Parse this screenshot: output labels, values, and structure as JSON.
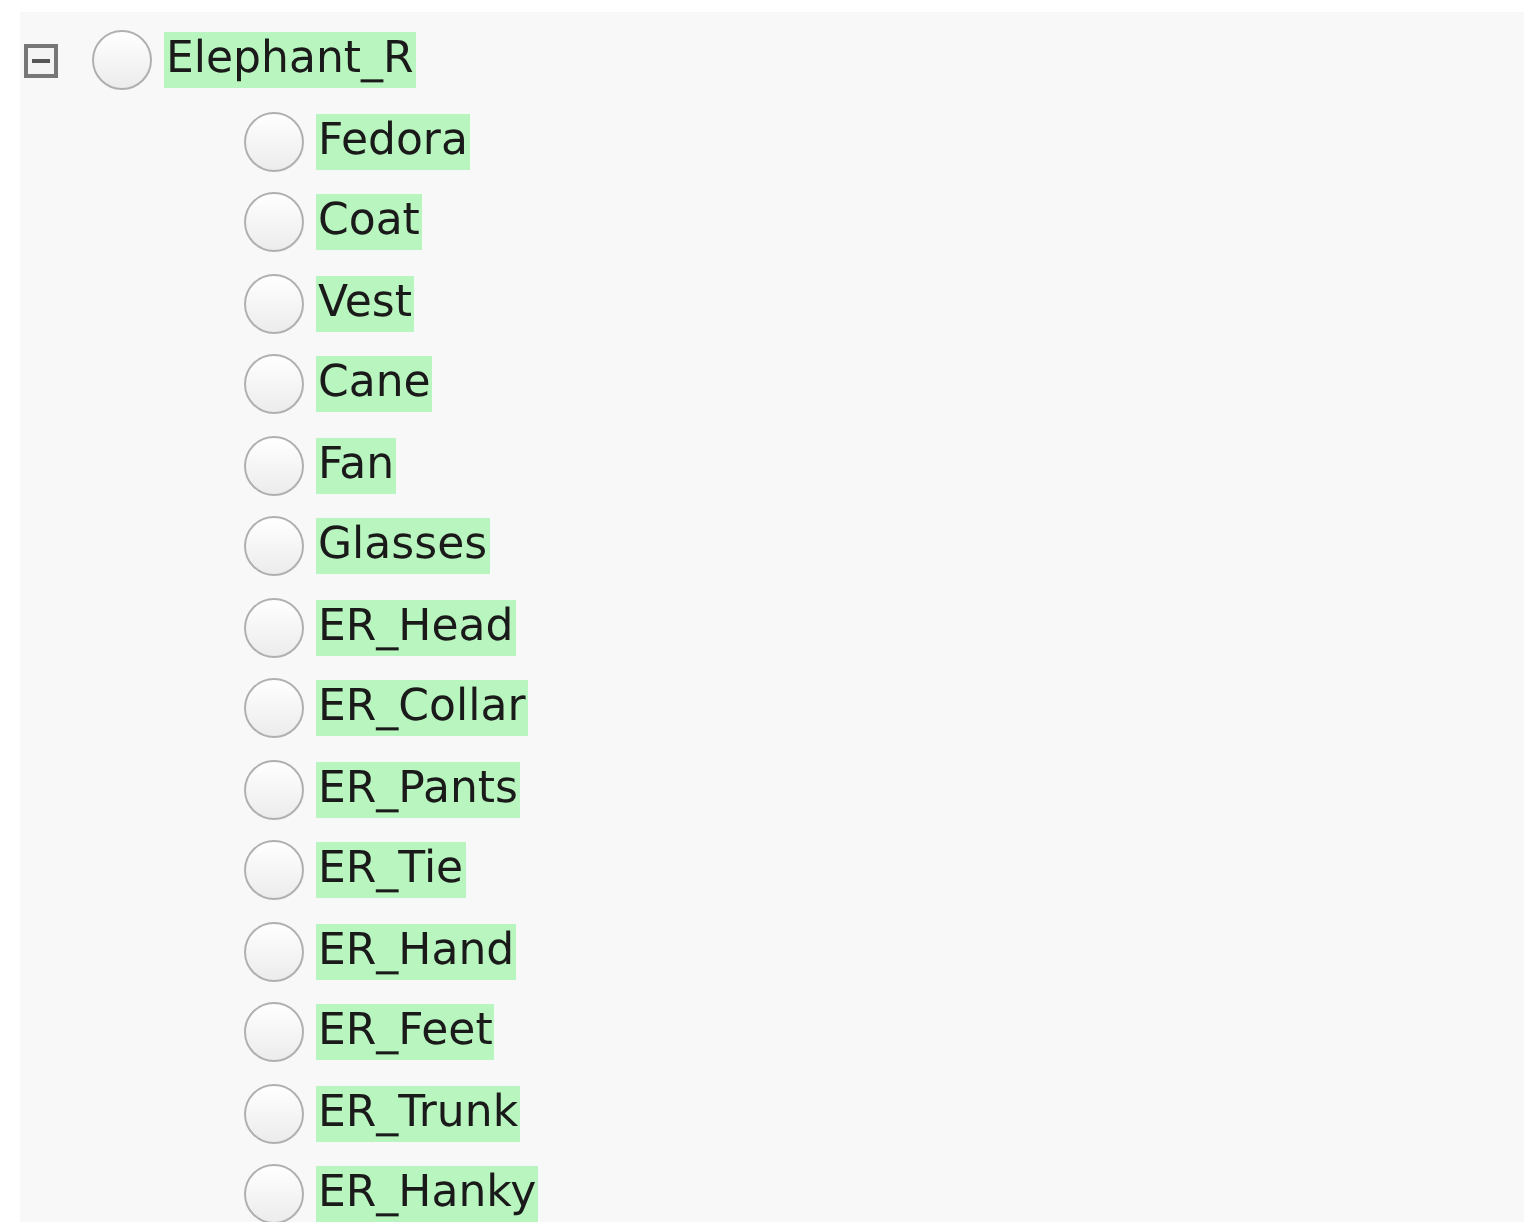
{
  "tree": {
    "label": "Elephant_R",
    "expanded": true,
    "selected": false,
    "children": [
      {
        "label": "Fedora",
        "selected": false
      },
      {
        "label": "Coat",
        "selected": false
      },
      {
        "label": "Vest",
        "selected": false
      },
      {
        "label": "Cane",
        "selected": false
      },
      {
        "label": "Fan",
        "selected": false
      },
      {
        "label": "Glasses",
        "selected": false
      },
      {
        "label": "ER_Head",
        "selected": false
      },
      {
        "label": "ER_Collar",
        "selected": false
      },
      {
        "label": "ER_Pants",
        "selected": false
      },
      {
        "label": "ER_Tie",
        "selected": false
      },
      {
        "label": "ER_Hand",
        "selected": false
      },
      {
        "label": "ER_Feet",
        "selected": false
      },
      {
        "label": "ER_Trunk",
        "selected": false
      },
      {
        "label": "ER_Hanky",
        "selected": false
      }
    ]
  }
}
